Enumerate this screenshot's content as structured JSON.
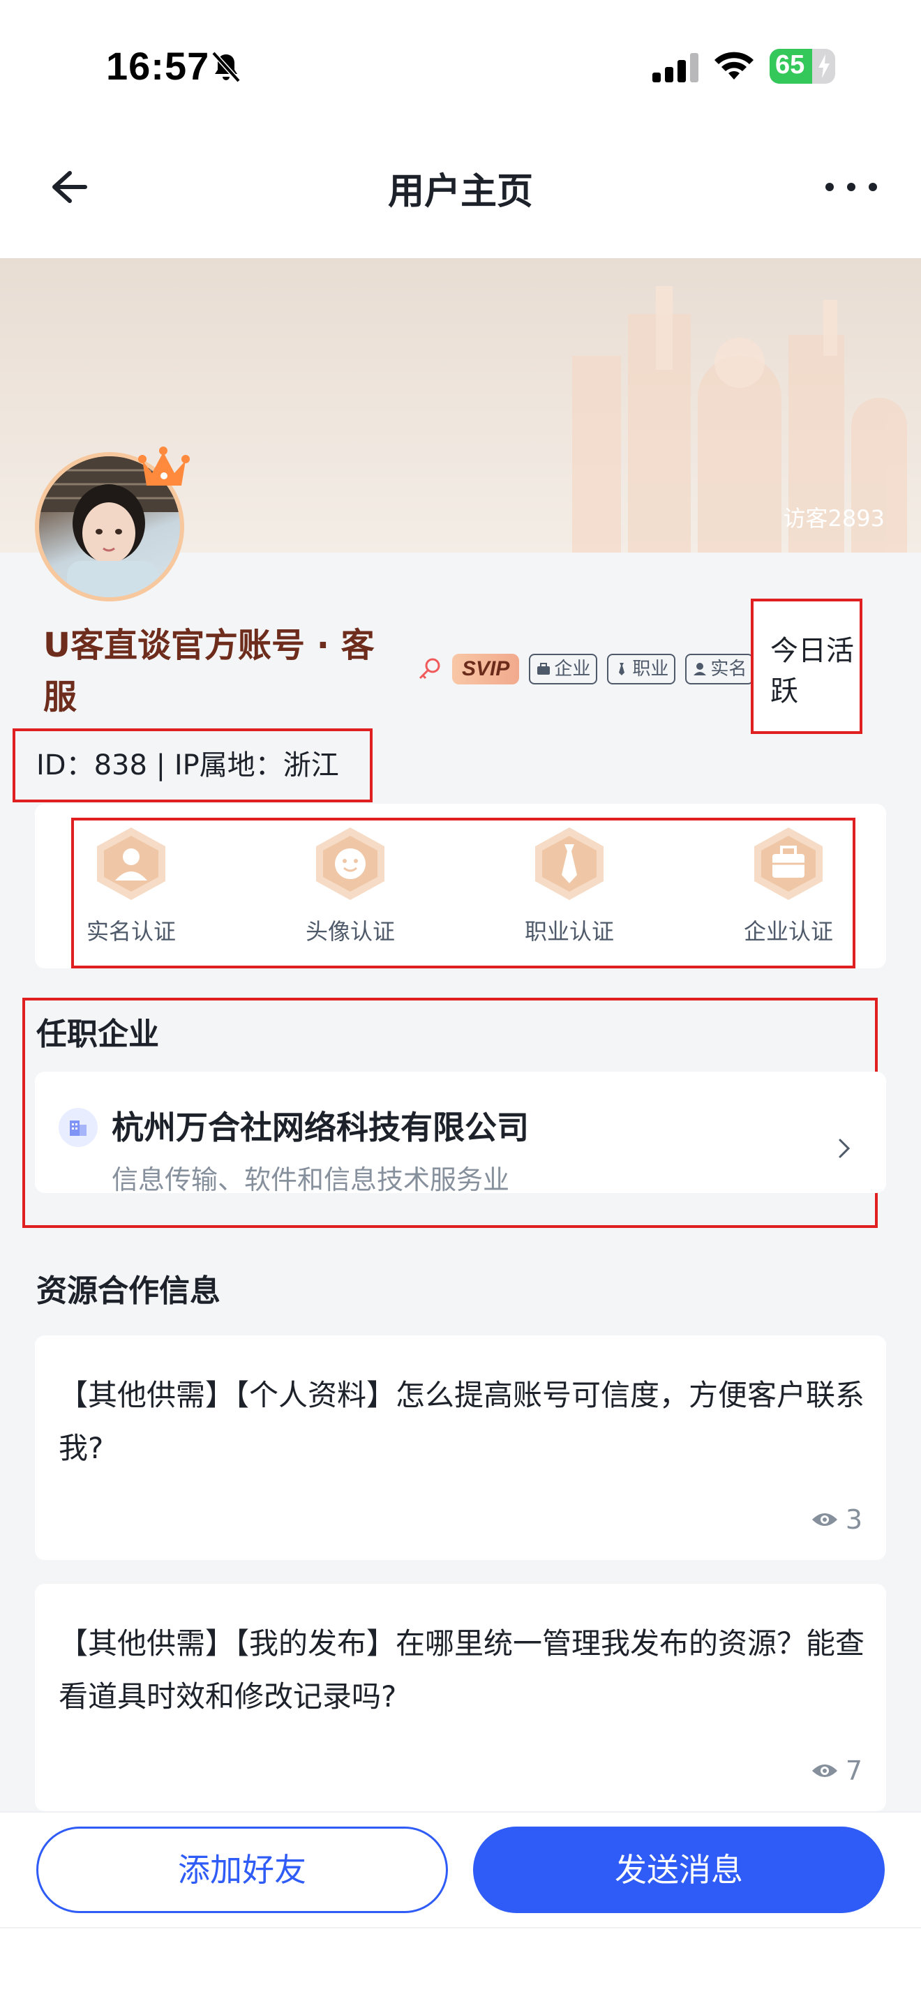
{
  "status_bar": {
    "time": "16:57",
    "battery_level": "65",
    "battery_fraction": 0.65,
    "icons": [
      "bell-muted-icon",
      "signal-icon",
      "wifi-icon",
      "battery-icon"
    ]
  },
  "nav": {
    "title": "用户主页",
    "icons": [
      "back-arrow-icon",
      "more-icon"
    ]
  },
  "banner": {
    "visitors": "访客2893"
  },
  "profile": {
    "name": "U客直谈官方账号 · 客服",
    "svip": "SVIP",
    "tags": [
      "企业",
      "职业",
      "实名"
    ],
    "active_status": "今日活跃",
    "id_line": "ID：838 | IP属地：浙江"
  },
  "certifications": [
    {
      "label": "实名认证",
      "icon": "person-icon"
    },
    {
      "label": "头像认证",
      "icon": "face-icon"
    },
    {
      "label": "职业认证",
      "icon": "tie-icon"
    },
    {
      "label": "企业认证",
      "icon": "briefcase-icon"
    }
  ],
  "employer": {
    "section_title": "任职企业",
    "company_name": "杭州万合社网络科技有限公司",
    "industry": "信息传输、软件和信息技术服务业"
  },
  "resources": {
    "section_title": "资源合作信息",
    "items": [
      {
        "text": "【其他供需】【个人资料】怎么提高账号可信度，方便客户联系我?",
        "views": "3"
      },
      {
        "text": "【其他供需】【我的发布】在哪里统一管理我发布的资源？能查看道具时效和修改记录吗?",
        "views": "7"
      }
    ]
  },
  "actions": {
    "add_friend": "添加好友",
    "send_message": "发送消息"
  },
  "colors": {
    "primary": "#2f5cf6",
    "name_color": "#6e2c1c",
    "highlight_border": "#e02020",
    "battery_green": "#34c759"
  }
}
